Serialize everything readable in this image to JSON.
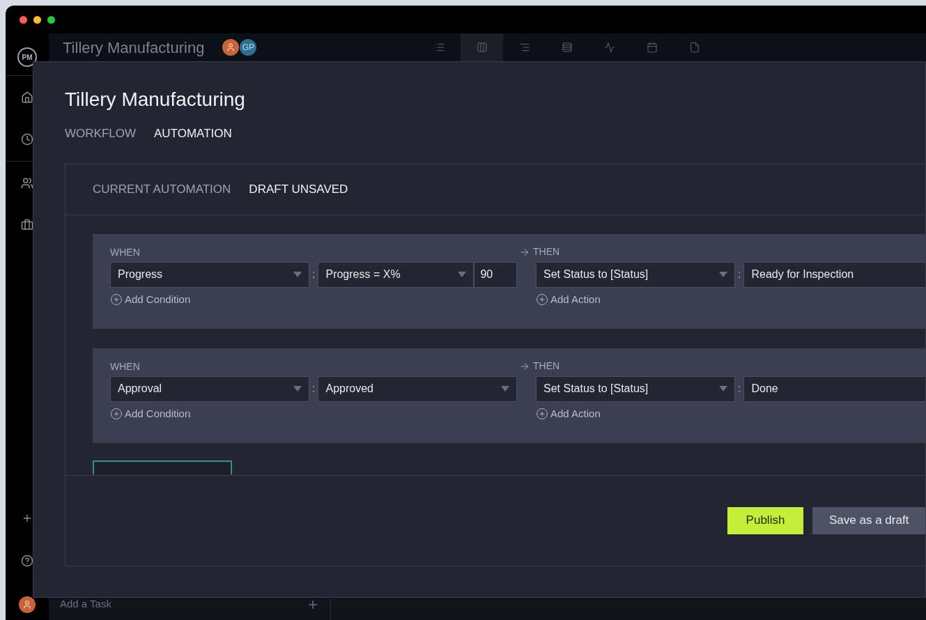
{
  "sidebar": {
    "logo": "PM"
  },
  "header": {
    "title": "Tillery Manufacturing",
    "avatars": [
      {
        "kind": "photo"
      },
      {
        "kind": "initials",
        "initials": "GP"
      }
    ],
    "view_tabs": [
      {
        "kind": "list",
        "selected": false
      },
      {
        "kind": "board",
        "selected": true
      },
      {
        "kind": "gantt",
        "selected": false
      },
      {
        "kind": "sheet",
        "selected": false
      },
      {
        "kind": "dashboard",
        "selected": false
      },
      {
        "kind": "calendar",
        "selected": false
      },
      {
        "kind": "files",
        "selected": false
      }
    ]
  },
  "task_input": {
    "placeholder": "Add a Task"
  },
  "modal": {
    "title": "Tillery Manufacturing",
    "tabs": [
      {
        "label": "WORKFLOW",
        "selected": false
      },
      {
        "label": "AUTOMATION",
        "selected": true
      }
    ],
    "panel": {
      "tabs": [
        {
          "label": "CURRENT AUTOMATION",
          "selected": false
        },
        {
          "label": "DRAFT UNSAVED",
          "selected": true
        }
      ],
      "rules": [
        {
          "when_label": "WHEN",
          "trigger": "Progress",
          "condition_separator": ":",
          "condition": "Progress = X%",
          "condition_value": "90",
          "add_condition": "Add Condition",
          "then_label": "THEN",
          "action": "Set Status to [Status]",
          "action_separator": ":",
          "action_value": "Ready for Inspection",
          "add_action": "Add Action"
        },
        {
          "when_label": "WHEN",
          "trigger": "Approval",
          "condition_separator": ":",
          "condition": "Approved",
          "add_condition": "Add Condition",
          "then_label": "THEN",
          "action": "Set Status to [Status]",
          "action_separator": ":",
          "action_value": "Done",
          "add_action": "Add Action"
        }
      ]
    },
    "buttons": [
      {
        "label": "Publish",
        "kind": "primary"
      },
      {
        "label": "Save as a draft",
        "kind": "secondary"
      }
    ]
  }
}
